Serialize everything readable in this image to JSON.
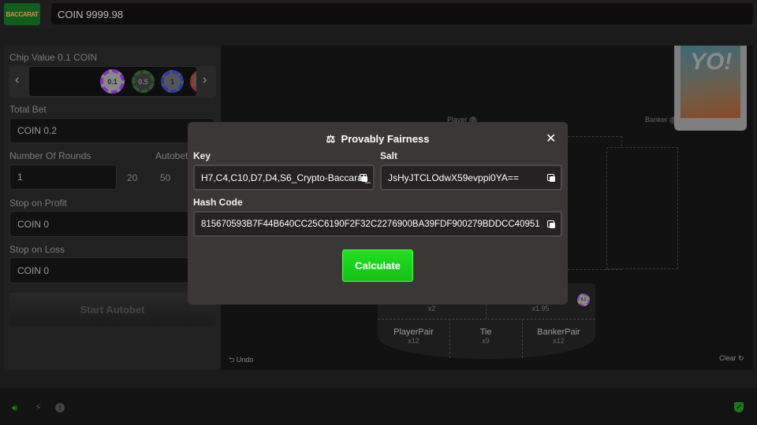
{
  "header": {
    "logo_text": "BACCARAT",
    "balance": "COIN 9999.98"
  },
  "left": {
    "chip_value_label": "Chip Value 0.1 COIN",
    "chips": [
      {
        "label": "0.1",
        "color": "#8a2fc0"
      },
      {
        "label": "0.5",
        "color": "#2a5a2a"
      },
      {
        "label": "1",
        "color": "#2a3ab0"
      },
      {
        "label": "",
        "color": "#a02a2a"
      }
    ],
    "total_bet_label": "Total Bet",
    "total_bet_value": "COIN 0.2",
    "rounds_label": "Number Of Rounds",
    "rounds_value": "1",
    "rounds_presets": [
      "20",
      "50"
    ],
    "autobet_label": "Autobet",
    "stop_profit_label": "Stop on Profit",
    "stop_profit_value": "COIN 0",
    "stop_loss_label": "Stop on Loss",
    "stop_loss_value": "COIN 0",
    "start_button": "Start Autobet"
  },
  "game": {
    "player_label": "Player",
    "banker_label": "Banker",
    "help": "?",
    "deck_logo": "YO!",
    "bets": [
      {
        "name": "",
        "mult": "x2"
      },
      {
        "name": "",
        "mult": "x1.95"
      },
      {
        "name": "PlayerPair",
        "mult": "x12"
      },
      {
        "name": "Tie",
        "mult": "x9"
      },
      {
        "name": "BankerPair",
        "mult": "x12"
      }
    ],
    "placed_chip": "0.1",
    "undo": "Undo",
    "clear": "Clear"
  },
  "modal": {
    "title": "Provably Fairness",
    "key_label": "Key",
    "key_value": "H7,C4,C10,D7,D4,S6_Crypto-Baccarat_",
    "salt_label": "Salt",
    "salt_value": "JsHyJTCLOdwX59evppi0YA==",
    "hash_label": "Hash Code",
    "hash_value": "815670593B7F44B640CC25C6190F2F32C2276900BA39FDF900279BDDCC40951",
    "calculate": "Calculate"
  }
}
